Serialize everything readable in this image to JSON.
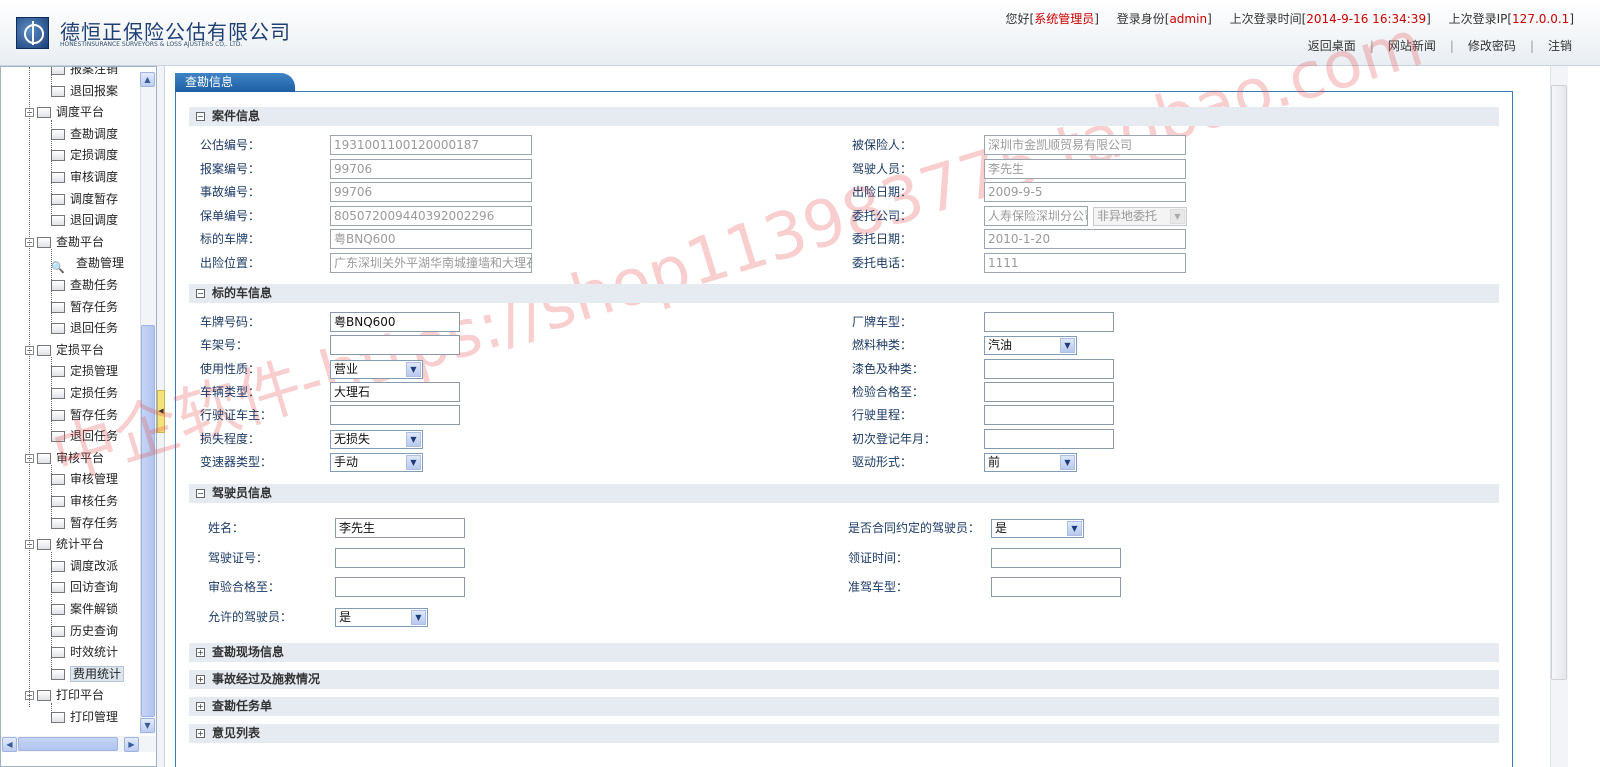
{
  "header": {
    "company_cn": "德恒正保险公估有限公司",
    "company_en": "HONESTINSURANCE SURVEYORS & LOSS AJUSTERS CO,. LTD.",
    "greeting": "您好",
    "user_name": "系统管理员",
    "role_label": "登录身份",
    "role": "admin",
    "last_login_label": "上次登录时间",
    "last_login": "2014-9-16 16:34:39",
    "last_ip_label": "上次登录IP",
    "last_ip": "127.0.0.1",
    "links": [
      "返回桌面",
      "网站新闻",
      "修改密码",
      "注销"
    ]
  },
  "sidebar": {
    "groups": [
      {
        "label": "",
        "items": [
          "报案注销",
          "退回报案"
        ]
      },
      {
        "label": "调度平台",
        "items": [
          "查勘调度",
          "定损调度",
          "审核调度",
          "调度暂存",
          "退回调度"
        ]
      },
      {
        "label": "查勘平台",
        "items": [
          "查勘管理",
          "查勘任务",
          "暂存任务",
          "退回任务"
        ]
      },
      {
        "label": "定损平台",
        "items": [
          "定损管理",
          "定损任务",
          "暂存任务",
          "退回任务"
        ]
      },
      {
        "label": "审核平台",
        "items": [
          "审核管理",
          "审核任务",
          "暂存任务"
        ]
      },
      {
        "label": "统计平台",
        "items": [
          "调度改派",
          "回访查询",
          "案件解锁",
          "历史查询",
          "时效统计",
          "费用统计"
        ]
      },
      {
        "label": "打印平台",
        "items": [
          "打印管理"
        ]
      }
    ],
    "selected": "费用统计"
  },
  "panel": {
    "title": "查勘信息"
  },
  "case": {
    "title": "案件信息",
    "left": [
      {
        "label": "公估编号：",
        "value": "1931001100120000187"
      },
      {
        "label": "报案编号：",
        "value": "99706"
      },
      {
        "label": "事故编号：",
        "value": "99706"
      },
      {
        "label": "保单编号：",
        "value": "805072009440392002296"
      },
      {
        "label": "标的车牌：",
        "value": "粤BNQ600"
      },
      {
        "label": "出险位置：",
        "value": "广东深圳关外平湖华南城撞墙和大理石"
      }
    ],
    "right": [
      {
        "label": "被保险人：",
        "value": "深圳市金凯顺贸易有限公司"
      },
      {
        "label": "驾驶人员：",
        "value": "李先生"
      },
      {
        "label": "出险日期：",
        "value": "2009-9-5"
      },
      {
        "label": "委托公司：",
        "value": "人寿保险深圳分公司",
        "select": "非异地委托"
      },
      {
        "label": "委托日期：",
        "value": "2010-1-20"
      },
      {
        "label": "委托电话：",
        "value": "1111"
      }
    ]
  },
  "vehicle": {
    "title": "标的车信息",
    "left": [
      {
        "label": "车牌号码：",
        "value": "粤BNQ600",
        "type": "input"
      },
      {
        "label": "车架号：",
        "value": "",
        "type": "input"
      },
      {
        "label": "使用性质：",
        "value": "营业",
        "type": "select"
      },
      {
        "label": "车辆类型：",
        "value": "大理石",
        "type": "input"
      },
      {
        "label": "行驶证车主：",
        "value": "",
        "type": "input"
      },
      {
        "label": "损失程度：",
        "value": "无损失",
        "type": "select"
      },
      {
        "label": "变速器类型：",
        "value": "手动",
        "type": "select"
      }
    ],
    "right": [
      {
        "label": "厂牌车型：",
        "value": "",
        "type": "input"
      },
      {
        "label": "燃料种类：",
        "value": "汽油",
        "type": "select"
      },
      {
        "label": "漆色及种类：",
        "value": "",
        "type": "input"
      },
      {
        "label": "检验合格至：",
        "value": "",
        "type": "input"
      },
      {
        "label": "行驶里程：",
        "value": "",
        "type": "input"
      },
      {
        "label": "初次登记年月：",
        "value": "",
        "type": "input"
      },
      {
        "label": "驱动形式：",
        "value": "前",
        "type": "select"
      }
    ]
  },
  "driver": {
    "title": "驾驶员信息",
    "left": [
      {
        "label": "姓名：",
        "value": "李先生",
        "type": "input"
      },
      {
        "label": "驾驶证号：",
        "value": "",
        "type": "input"
      },
      {
        "label": "审验合格至：",
        "value": "",
        "type": "input"
      },
      {
        "label": "允许的驾驶员：",
        "value": "是",
        "type": "select"
      }
    ],
    "right": [
      {
        "label": "是否合同约定的驾驶员：",
        "value": "是",
        "type": "select"
      },
      {
        "label": "领证时间：",
        "value": "",
        "type": "input"
      },
      {
        "label": "准驾车型：",
        "value": "",
        "type": "input"
      }
    ]
  },
  "collapsed_sections": [
    "查勘现场信息",
    "事故经过及施救情况",
    "查勘任务单",
    "意见列表"
  ],
  "watermark": "中企软件-https://shop113983775.taobao.com"
}
